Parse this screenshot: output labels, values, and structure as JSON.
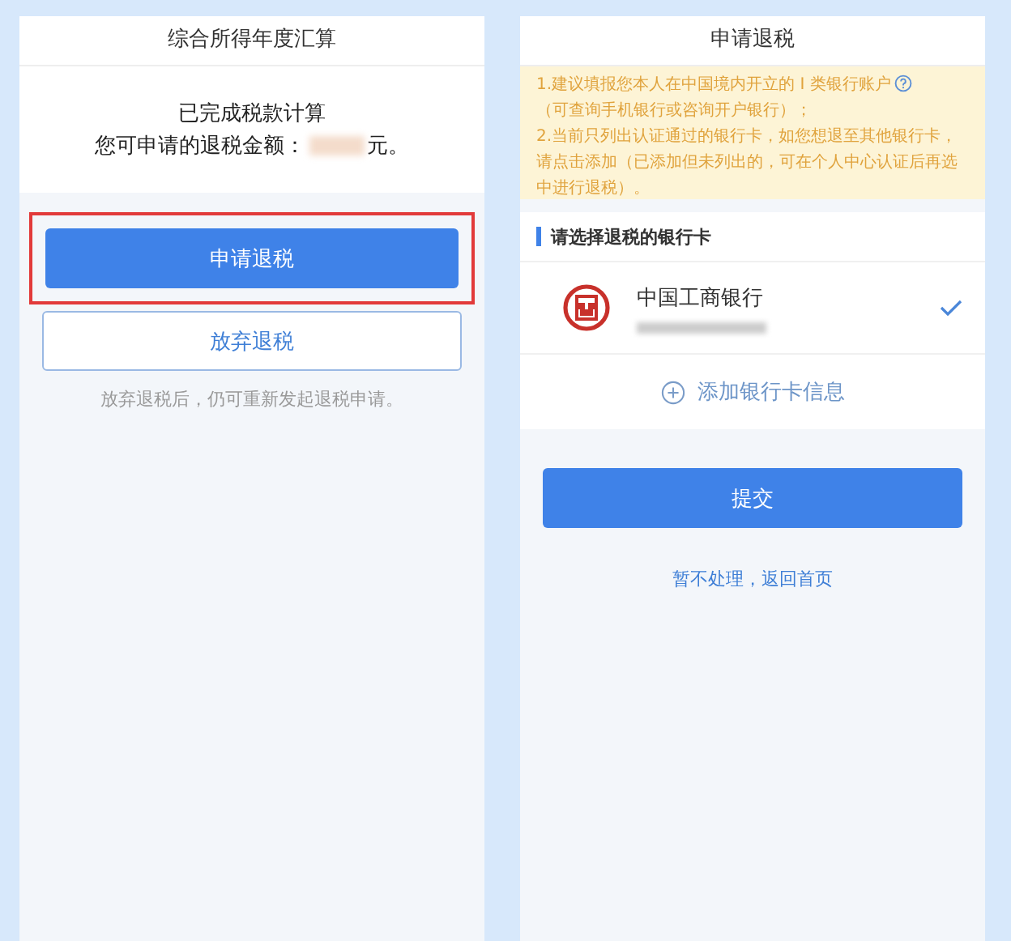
{
  "left_screen": {
    "title": "综合所得年度汇算",
    "result": {
      "line_1": "已完成税款计算",
      "amount_label": "您可申请的退税金额：",
      "amount_hidden": true,
      "unit": "元。"
    },
    "apply_button": {
      "label": "申请退税",
      "highlighted": true
    },
    "abandon_button": {
      "label": "放弃退税"
    },
    "hint": "放弃退税后，仍可重新发起退税申请。"
  },
  "right_screen": {
    "title": "申请退税",
    "notice": {
      "part_1": "1.建议填报您本人在中国境内开立的 I 类银行账户",
      "part_2": "（可查询手机银行或咨询开户银行）；",
      "part_3": "2.当前只列出认证通过的银行卡，如您想退至其他银行卡，请点击添加（已添加但未列出的，可在个人中心认证后再选中进行退税）。"
    },
    "section_title": "请选择退税的银行卡",
    "banks": [
      {
        "name": "中国工商银行",
        "number_hidden": true,
        "selected": true
      }
    ],
    "add_card": "添加银行卡信息",
    "submit_button": "提交",
    "skip_link": "暂不处理，返回首页"
  }
}
